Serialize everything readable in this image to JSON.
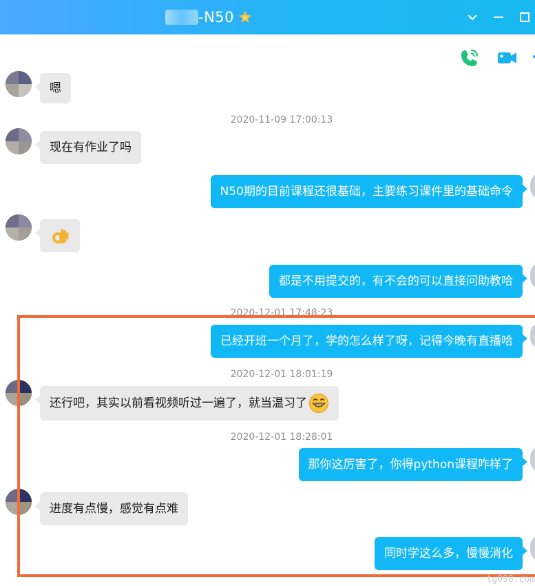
{
  "window": {
    "title": "-N50",
    "star_icon": "badge-star-icon",
    "controls": [
      "chevron-down-icon",
      "minimize-icon",
      "maximize-icon"
    ]
  },
  "actions": {
    "voice_call_icon": "phone-call-icon",
    "video_call_icon": "video-camera-icon"
  },
  "messages": [
    {
      "side": "left",
      "text": "嗯"
    },
    {
      "type": "time",
      "text": "2020-11-09 17:00:13"
    },
    {
      "side": "left",
      "text": "现在有作业了吗"
    },
    {
      "side": "right",
      "text": "N50期的目前课程还很基础，主要练习课件里的基础命令"
    },
    {
      "side": "left",
      "text": "",
      "emoji": "ok-hand-emoji"
    },
    {
      "side": "right",
      "text": "都是不用提交的，有不会的可以直接问助教哈"
    },
    {
      "type": "time",
      "text": "2020-12-01 17:48:23"
    },
    {
      "side": "right",
      "text": "已经开班一个月了，学的怎么样了呀，记得今晚有直播哈"
    },
    {
      "type": "time",
      "text": "2020-12-01 18:01:19"
    },
    {
      "side": "left",
      "text": "还行吧，其实以前看视频听过一遍了，就当温习了",
      "emoji": "grin-emoji"
    },
    {
      "type": "time",
      "text": "2020-12-01 18:28:01"
    },
    {
      "side": "right",
      "text": "那你这厉害了，你得python课程咋样了"
    },
    {
      "side": "left",
      "text": "进度有点慢，感觉有点难"
    },
    {
      "side": "right",
      "text": "同时学这么多，慢慢消化"
    }
  ],
  "watermark": "tg098.com",
  "colors": {
    "titlebar": "#1fb6f5",
    "bubble_out": "#12b7f5",
    "bubble_in": "#e9e9e9",
    "highlight": "#f26a38",
    "call_green": "#22c27a",
    "video_blue": "#19b2ef"
  }
}
